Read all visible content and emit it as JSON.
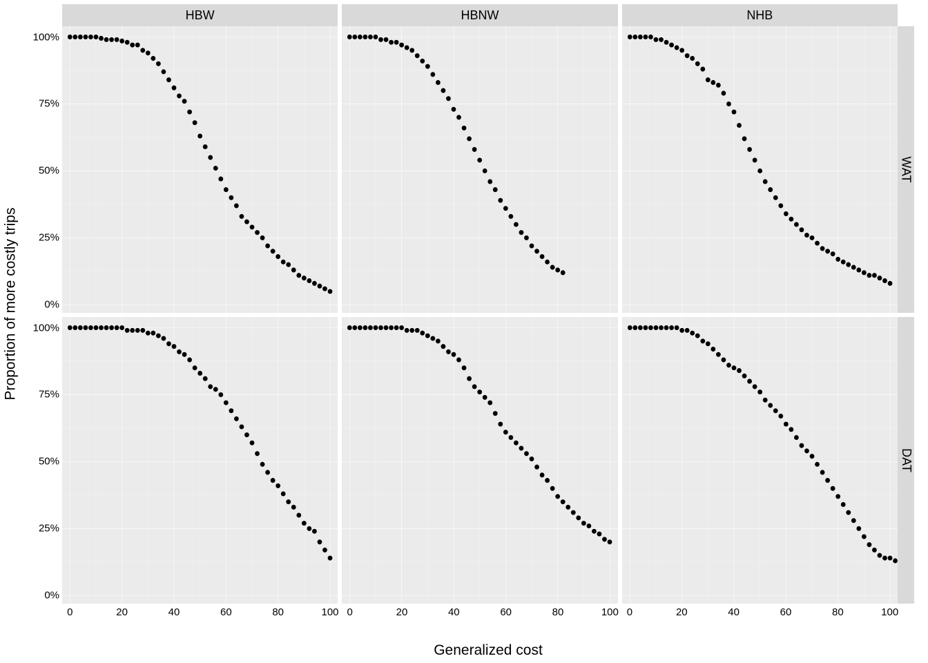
{
  "xlabel": "Generalized cost",
  "ylabel": "Proportion of more costly trips",
  "col_facets": [
    "HBW",
    "HBNW",
    "NHB"
  ],
  "row_facets": [
    "WAT",
    "DAT"
  ],
  "x_breaks": [
    0,
    20,
    40,
    60,
    80,
    100
  ],
  "y_breaks": [
    0,
    25,
    50,
    75,
    100
  ],
  "y_tick_labels": [
    "0%",
    "25%",
    "50%",
    "75%",
    "100%"
  ],
  "x_range": [
    -3,
    103
  ],
  "y_range": [
    -3,
    104
  ],
  "chart_data": [
    {
      "row": "WAT",
      "col": "HBW",
      "type": "scatter",
      "x": [
        0,
        2,
        4,
        6,
        8,
        10,
        12,
        14,
        16,
        18,
        20,
        22,
        24,
        26,
        28,
        30,
        32,
        34,
        36,
        38,
        40,
        42,
        44,
        46,
        48,
        50,
        52,
        54,
        56,
        58,
        60,
        62,
        64,
        66,
        68,
        70,
        72,
        74,
        76,
        78,
        80,
        82,
        84,
        86,
        88,
        90,
        92,
        94,
        96,
        98,
        100
      ],
      "y": [
        100,
        100,
        100,
        100,
        100,
        100,
        99.5,
        99,
        99,
        99,
        98.5,
        98,
        97,
        97,
        95,
        94,
        92,
        90,
        87,
        84,
        81,
        78,
        76,
        72,
        68,
        63,
        59,
        55,
        51,
        47,
        43,
        40,
        37,
        33,
        31,
        29,
        27,
        25,
        22,
        20,
        18,
        16,
        15,
        13,
        11,
        10,
        9,
        8,
        7,
        6,
        5
      ]
    },
    {
      "row": "WAT",
      "col": "HBNW",
      "type": "scatter",
      "x": [
        0,
        2,
        4,
        6,
        8,
        10,
        12,
        14,
        16,
        18,
        20,
        22,
        24,
        26,
        28,
        30,
        32,
        34,
        36,
        38,
        40,
        42,
        44,
        46,
        48,
        50,
        52,
        54,
        56,
        58,
        60,
        62,
        64,
        66,
        68,
        70,
        72,
        74,
        76,
        78,
        80,
        82
      ],
      "y": [
        100,
        100,
        100,
        100,
        100,
        100,
        99,
        99,
        98,
        98,
        97,
        96,
        95,
        93,
        91,
        89,
        86,
        83,
        80,
        77,
        73,
        70,
        66,
        62,
        58,
        54,
        50,
        46,
        43,
        39,
        36,
        33,
        30,
        27,
        25,
        22,
        20,
        18,
        16,
        14,
        13,
        12
      ]
    },
    {
      "row": "WAT",
      "col": "NHB",
      "type": "scatter",
      "x": [
        0,
        2,
        4,
        6,
        8,
        10,
        12,
        14,
        16,
        18,
        20,
        22,
        24,
        26,
        28,
        30,
        32,
        34,
        36,
        38,
        40,
        42,
        44,
        46,
        48,
        50,
        52,
        54,
        56,
        58,
        60,
        62,
        64,
        66,
        68,
        70,
        72,
        74,
        76,
        78,
        80,
        82,
        84,
        86,
        88,
        90,
        92,
        94,
        96,
        98,
        100
      ],
      "y": [
        100,
        100,
        100,
        100,
        100,
        99,
        99,
        98,
        97,
        96,
        95,
        93,
        92,
        90,
        88,
        84,
        83,
        82,
        79,
        75,
        72,
        67,
        62,
        58,
        54,
        50,
        46,
        43,
        40,
        37,
        34,
        32,
        30,
        28,
        26,
        25,
        23,
        21,
        20,
        19,
        17,
        16,
        15,
        14,
        13,
        12,
        11,
        11,
        10,
        9,
        8
      ]
    },
    {
      "row": "DAT",
      "col": "HBW",
      "type": "scatter",
      "x": [
        0,
        2,
        4,
        6,
        8,
        10,
        12,
        14,
        16,
        18,
        20,
        22,
        24,
        26,
        28,
        30,
        32,
        34,
        36,
        38,
        40,
        42,
        44,
        46,
        48,
        50,
        52,
        54,
        56,
        58,
        60,
        62,
        64,
        66,
        68,
        70,
        72,
        74,
        76,
        78,
        80,
        82,
        84,
        86,
        88,
        90,
        92,
        94,
        96,
        98,
        100
      ],
      "y": [
        100,
        100,
        100,
        100,
        100,
        100,
        100,
        100,
        100,
        100,
        100,
        99,
        99,
        99,
        99,
        98,
        98,
        97,
        96,
        94,
        93,
        91,
        90,
        88,
        85,
        83,
        81,
        78,
        77,
        75,
        72,
        69,
        66,
        63,
        60,
        57,
        53,
        49,
        46,
        43,
        41,
        38,
        35,
        33,
        30,
        27,
        25,
        24,
        20,
        17,
        14
      ]
    },
    {
      "row": "DAT",
      "col": "HBNW",
      "type": "scatter",
      "x": [
        0,
        2,
        4,
        6,
        8,
        10,
        12,
        14,
        16,
        18,
        20,
        22,
        24,
        26,
        28,
        30,
        32,
        34,
        36,
        38,
        40,
        42,
        44,
        46,
        48,
        50,
        52,
        54,
        56,
        58,
        60,
        62,
        64,
        66,
        68,
        70,
        72,
        74,
        76,
        78,
        80,
        82,
        84,
        86,
        88,
        90,
        92,
        94,
        96,
        98,
        100
      ],
      "y": [
        100,
        100,
        100,
        100,
        100,
        100,
        100,
        100,
        100,
        100,
        100,
        99,
        99,
        99,
        98,
        97,
        96,
        95,
        93,
        91,
        90,
        88,
        85,
        81,
        78,
        76,
        74,
        72,
        68,
        64,
        61,
        59,
        57,
        55,
        53,
        51,
        48,
        45,
        43,
        40,
        37,
        35,
        33,
        31,
        29,
        27,
        26,
        24,
        23,
        21,
        20
      ]
    },
    {
      "row": "DAT",
      "col": "NHB",
      "type": "scatter",
      "x": [
        0,
        2,
        4,
        6,
        8,
        10,
        12,
        14,
        16,
        18,
        20,
        22,
        24,
        26,
        28,
        30,
        32,
        34,
        36,
        38,
        40,
        42,
        44,
        46,
        48,
        50,
        52,
        54,
        56,
        58,
        60,
        62,
        64,
        66,
        68,
        70,
        72,
        74,
        76,
        78,
        80,
        82,
        84,
        86,
        88,
        90,
        92,
        94,
        96,
        98,
        100,
        102
      ],
      "y": [
        100,
        100,
        100,
        100,
        100,
        100,
        100,
        100,
        100,
        100,
        99,
        99,
        98,
        97,
        95,
        94,
        92,
        90,
        88,
        86,
        85,
        84,
        82,
        80,
        78,
        76,
        73,
        71,
        69,
        67,
        64,
        62,
        59,
        56,
        54,
        52,
        49,
        46,
        43,
        40,
        37,
        34,
        31,
        28,
        25,
        22,
        19,
        17,
        15,
        14,
        14,
        13
      ]
    }
  ]
}
